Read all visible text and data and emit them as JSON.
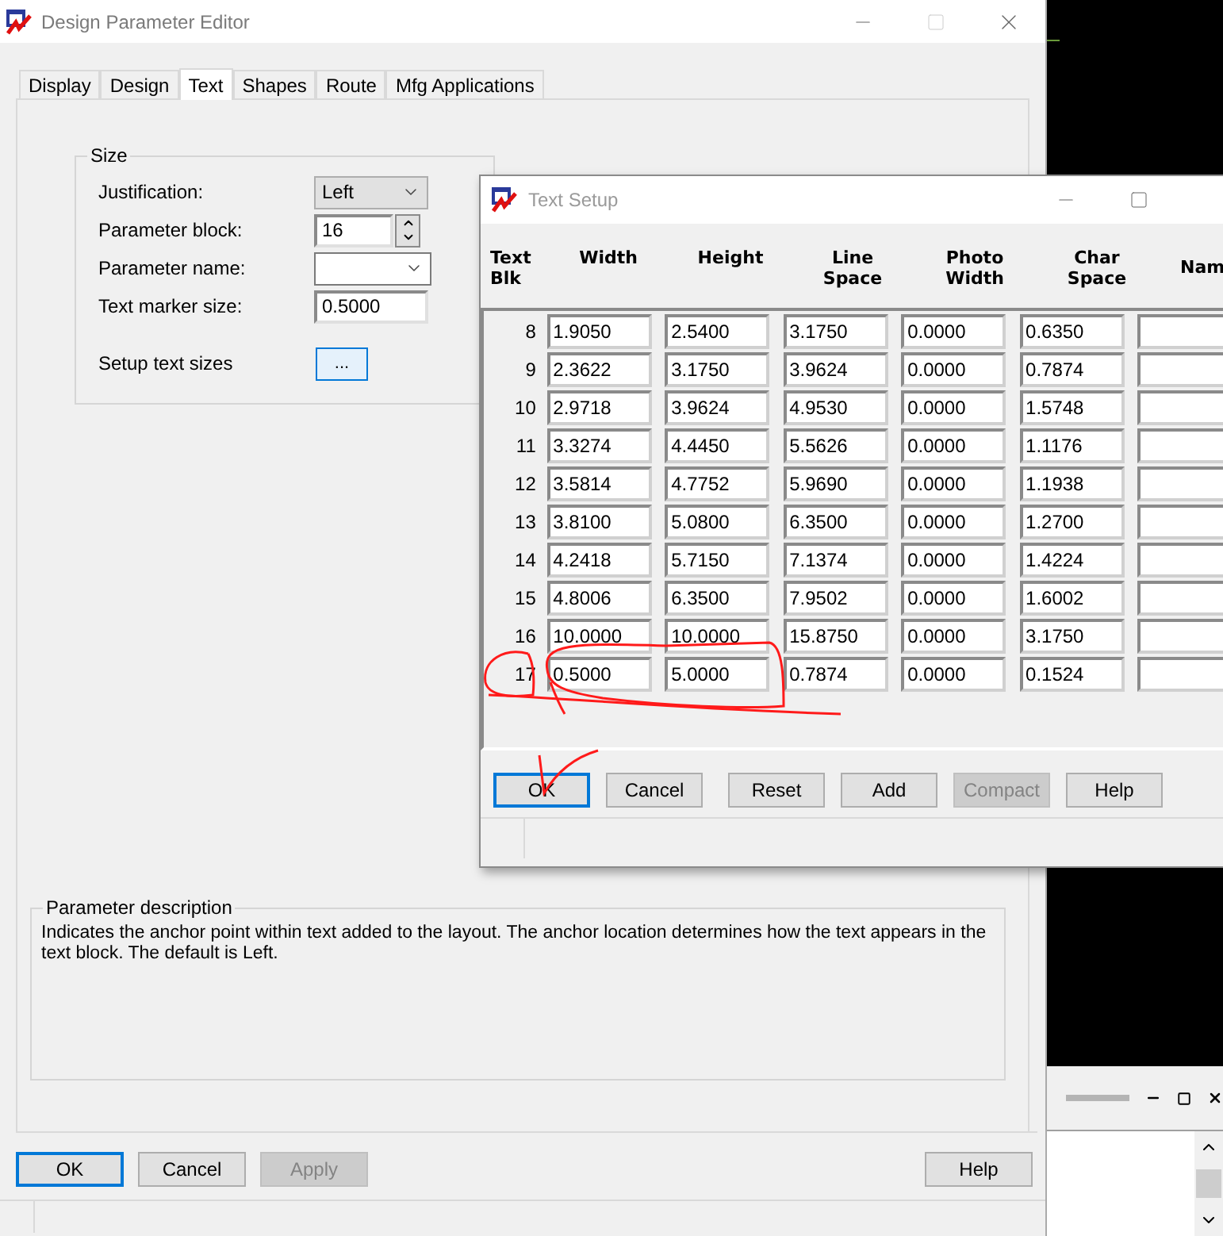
{
  "window": {
    "title": "Design Parameter Editor"
  },
  "tabs": [
    {
      "label": "Display",
      "selected": false
    },
    {
      "label": "Design",
      "selected": false
    },
    {
      "label": "Text",
      "selected": true
    },
    {
      "label": "Shapes",
      "selected": false
    },
    {
      "label": "Route",
      "selected": false
    },
    {
      "label": "Mfg Applications",
      "selected": false
    }
  ],
  "size_group": {
    "title": "Size",
    "fields": [
      {
        "kind": "dropdown",
        "label": "Justification:",
        "value": "Left"
      },
      {
        "kind": "spinner",
        "label": "Parameter block:",
        "value": "16"
      },
      {
        "kind": "combo",
        "label": "Parameter name:"
      },
      {
        "kind": "input",
        "label": "Text marker size:",
        "value": "0.5000"
      },
      {
        "kind": "button",
        "label": "Setup text sizes",
        "button": "..."
      }
    ]
  },
  "description": {
    "title": "Parameter description",
    "text": "Indicates the anchor point within text added to the layout. The anchor location determines how the text appears in the text block. The default is Left."
  },
  "buttons": [
    {
      "label": "OK",
      "default": true,
      "disabled": false
    },
    {
      "label": "Cancel",
      "default": false,
      "disabled": false
    },
    {
      "label": "Apply",
      "default": false,
      "disabled": true
    },
    {
      "label": "Help",
      "default": false,
      "disabled": false
    }
  ],
  "text_setup": {
    "title": "Text Setup",
    "columns": [
      "Text\nBlk",
      "Width",
      "Height",
      "Line\nSpace",
      "Photo\nWidth",
      "Char\nSpace",
      "Nam"
    ],
    "rows": [
      {
        "blk": "8",
        "cells": [
          "1.9050",
          "2.5400",
          "3.1750",
          "0.0000",
          "0.6350"
        ]
      },
      {
        "blk": "9",
        "cells": [
          "2.3622",
          "3.1750",
          "3.9624",
          "0.0000",
          "0.7874"
        ]
      },
      {
        "blk": "10",
        "cells": [
          "2.9718",
          "3.9624",
          "4.9530",
          "0.0000",
          "1.5748"
        ]
      },
      {
        "blk": "11",
        "cells": [
          "3.3274",
          "4.4450",
          "5.5626",
          "0.0000",
          "1.1176"
        ]
      },
      {
        "blk": "12",
        "cells": [
          "3.5814",
          "4.7752",
          "5.9690",
          "0.0000",
          "1.1938"
        ]
      },
      {
        "blk": "13",
        "cells": [
          "3.8100",
          "5.0800",
          "6.3500",
          "0.0000",
          "1.2700"
        ]
      },
      {
        "blk": "14",
        "cells": [
          "4.2418",
          "5.7150",
          "7.1374",
          "0.0000",
          "1.4224"
        ]
      },
      {
        "blk": "15",
        "cells": [
          "4.8006",
          "6.3500",
          "7.9502",
          "0.0000",
          "1.6002"
        ]
      },
      {
        "blk": "16",
        "cells": [
          "10.0000",
          "10.0000",
          "15.8750",
          "0.0000",
          "3.1750"
        ]
      },
      {
        "blk": "17",
        "cells": [
          "0.5000",
          "5.0000",
          "0.7874",
          "0.0000",
          "0.1524"
        ]
      }
    ],
    "buttons": [
      {
        "label": "OK",
        "default": true,
        "disabled": false
      },
      {
        "label": "Cancel",
        "default": false,
        "disabled": false
      },
      {
        "label": "Reset",
        "default": false,
        "disabled": false
      },
      {
        "label": "Add",
        "default": false,
        "disabled": false
      },
      {
        "label": "Compact",
        "default": false,
        "disabled": true
      },
      {
        "label": "Help",
        "default": false,
        "disabled": false
      }
    ]
  }
}
